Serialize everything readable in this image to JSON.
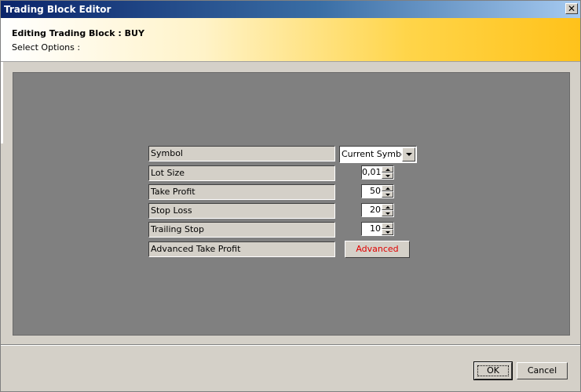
{
  "window": {
    "title": "Trading Block Editor",
    "close_glyph": "✕"
  },
  "header": {
    "title": "Editing Trading Block : BUY",
    "subtitle": "Select Options :"
  },
  "form": {
    "symbol": {
      "label": "Symbol",
      "value": "Current Symbol"
    },
    "lot_size": {
      "label": "Lot Size",
      "value": "0,01"
    },
    "take_profit": {
      "label": "Take Profit",
      "value": "50"
    },
    "stop_loss": {
      "label": "Stop Loss",
      "value": "20"
    },
    "trailing_stop": {
      "label": "Trailing Stop",
      "value": "10"
    },
    "advanced_take_profit": {
      "label": "Advanced Take Profit",
      "button": "Advanced"
    }
  },
  "footer": {
    "ok_label": "OK",
    "cancel_label": "Cancel"
  },
  "colors": {
    "title_bar": "#0a246a",
    "header_gradient_end": "#ffc21a",
    "content_bg": "#808080",
    "advanced_text": "#e00000"
  }
}
